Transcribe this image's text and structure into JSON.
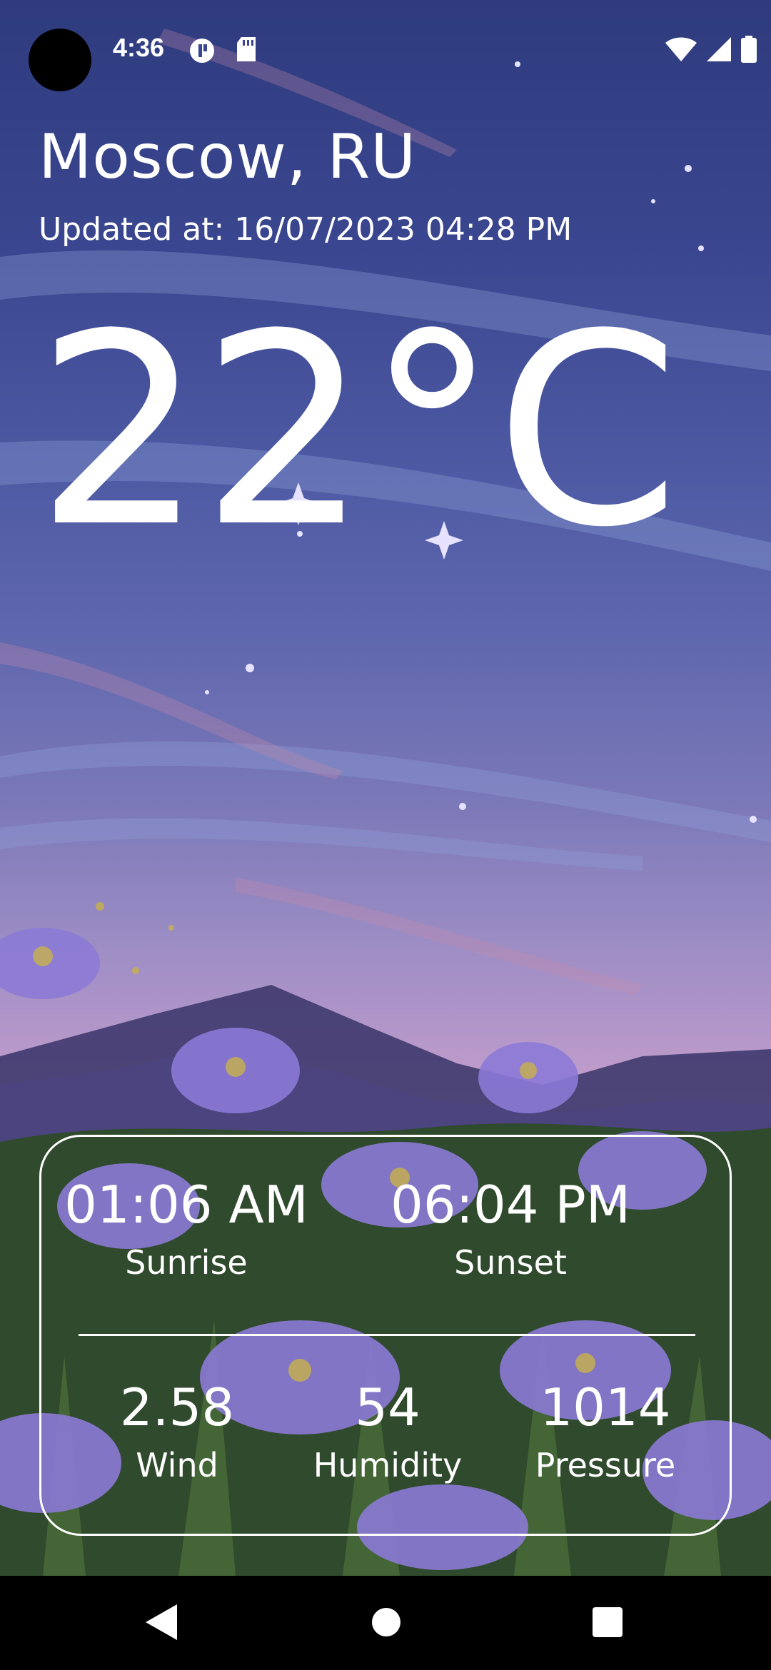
{
  "status_bar": {
    "time": "4:36",
    "icons_left": [
      "camera-dot",
      "data-saver-icon",
      "sd-card-icon"
    ],
    "icons_right": [
      "wifi-icon",
      "signal-icon",
      "battery-icon"
    ]
  },
  "weather": {
    "city": "Moscow, RU",
    "updated": "Updated at: 16/07/2023 04:28 PM",
    "temperature": "22°C"
  },
  "details": {
    "sunrise": {
      "value": "01:06 AM",
      "label": "Sunrise"
    },
    "sunset": {
      "value": "06:04 PM",
      "label": "Sunset"
    },
    "wind": {
      "value": "2.58",
      "label": "Wind"
    },
    "humidity": {
      "value": "54",
      "label": "Humidity"
    },
    "pressure": {
      "value": "1014",
      "label": "Pressure"
    }
  },
  "nav_bar": {
    "buttons": [
      "back-icon",
      "home-icon",
      "recents-icon"
    ]
  },
  "colors": {
    "text": "#ffffff",
    "sky_top": "#2f3b7e",
    "sky_mid": "#9a8cc4",
    "meadow": "#2f4a2c",
    "nav_bar": "#000000"
  }
}
